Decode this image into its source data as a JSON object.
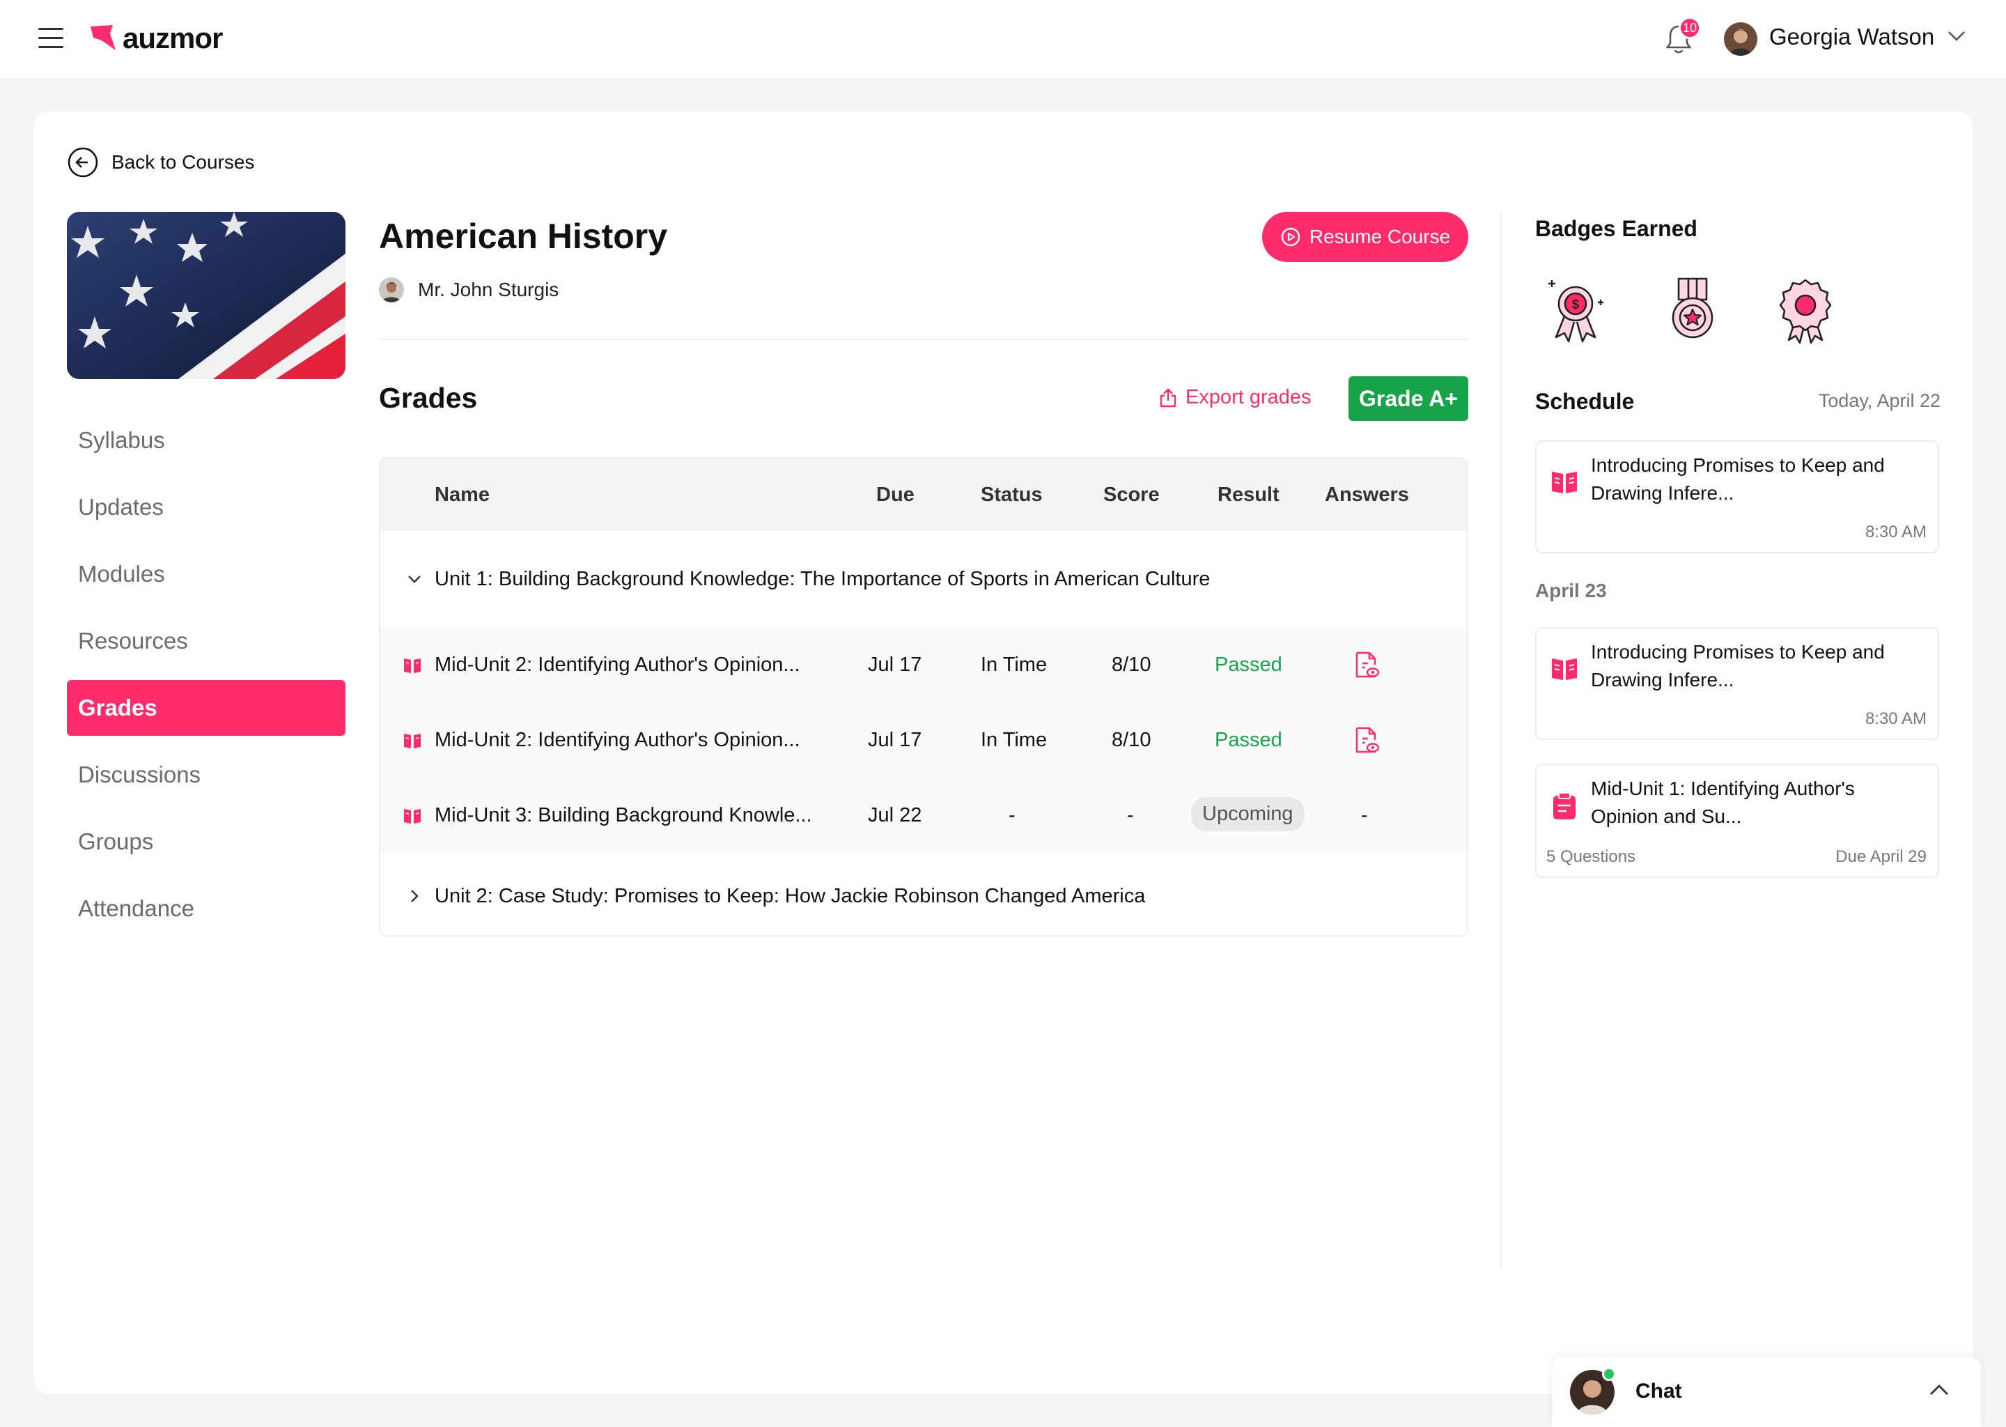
{
  "brand": {
    "name": "auzmor",
    "accent": "#ff2b6a",
    "success": "#17a34a"
  },
  "header": {
    "notifications": "10",
    "user_name": "Georgia Watson"
  },
  "back_label": "Back to Courses",
  "course": {
    "title": "American History",
    "teacher": "Mr. John Sturgis",
    "resume_label": "Resume Course"
  },
  "nav": {
    "items": [
      {
        "label": "Syllabus",
        "active": false
      },
      {
        "label": "Updates",
        "active": false
      },
      {
        "label": "Modules",
        "active": false
      },
      {
        "label": "Resources",
        "active": false
      },
      {
        "label": "Grades",
        "active": true
      },
      {
        "label": "Discussions",
        "active": false
      },
      {
        "label": "Groups",
        "active": false
      },
      {
        "label": "Attendance",
        "active": false
      }
    ]
  },
  "grades": {
    "title": "Grades",
    "export_label": "Export grades",
    "overall": "Grade A+",
    "columns": [
      "Name",
      "Due",
      "Status",
      "Score",
      "Result",
      "Answers"
    ],
    "units": [
      {
        "label": "Unit 1: Building Background Knowledge: The Importance of Sports in American Culture",
        "expanded": true,
        "rows": [
          {
            "name": "Mid-Unit 2: Identifying Author's Opinion...",
            "due": "Jul 17",
            "status": "In Time",
            "score": "8/10",
            "result": "Passed",
            "answers": "view-answers-icon"
          },
          {
            "name": "Mid-Unit 2: Identifying Author's Opinion...",
            "due": "Jul 17",
            "status": "In Time",
            "score": "8/10",
            "result": "Passed",
            "answers": "view-answers-icon"
          },
          {
            "name": "Mid-Unit 3: Building Background Knowle...",
            "due": "Jul 22",
            "status": "-",
            "score": "-",
            "result": "Upcoming",
            "answers": "-"
          }
        ]
      },
      {
        "label": "Unit 2: Case Study: Promises to Keep: How Jackie Robinson Changed America",
        "expanded": false,
        "rows": []
      }
    ]
  },
  "badges": {
    "title": "Badges Earned",
    "items": [
      "dollar-medal-icon",
      "star-medal-icon",
      "rosette-icon"
    ]
  },
  "schedule": {
    "title": "Schedule",
    "today_label": "Today, April 22",
    "day2_label": "April 23",
    "cards": [
      {
        "title": "Introducing Promises to Keep and Drawing Infere...",
        "time": "8:30 AM"
      },
      {
        "title": "Introducing Promises to Keep and Drawing Infere...",
        "time": "8:30 AM"
      },
      {
        "title": "Mid-Unit 1: Identifying Author's Opinion and Su...",
        "questions": "5 Questions",
        "due": "Due April 29"
      }
    ]
  },
  "chat": {
    "label": "Chat"
  }
}
